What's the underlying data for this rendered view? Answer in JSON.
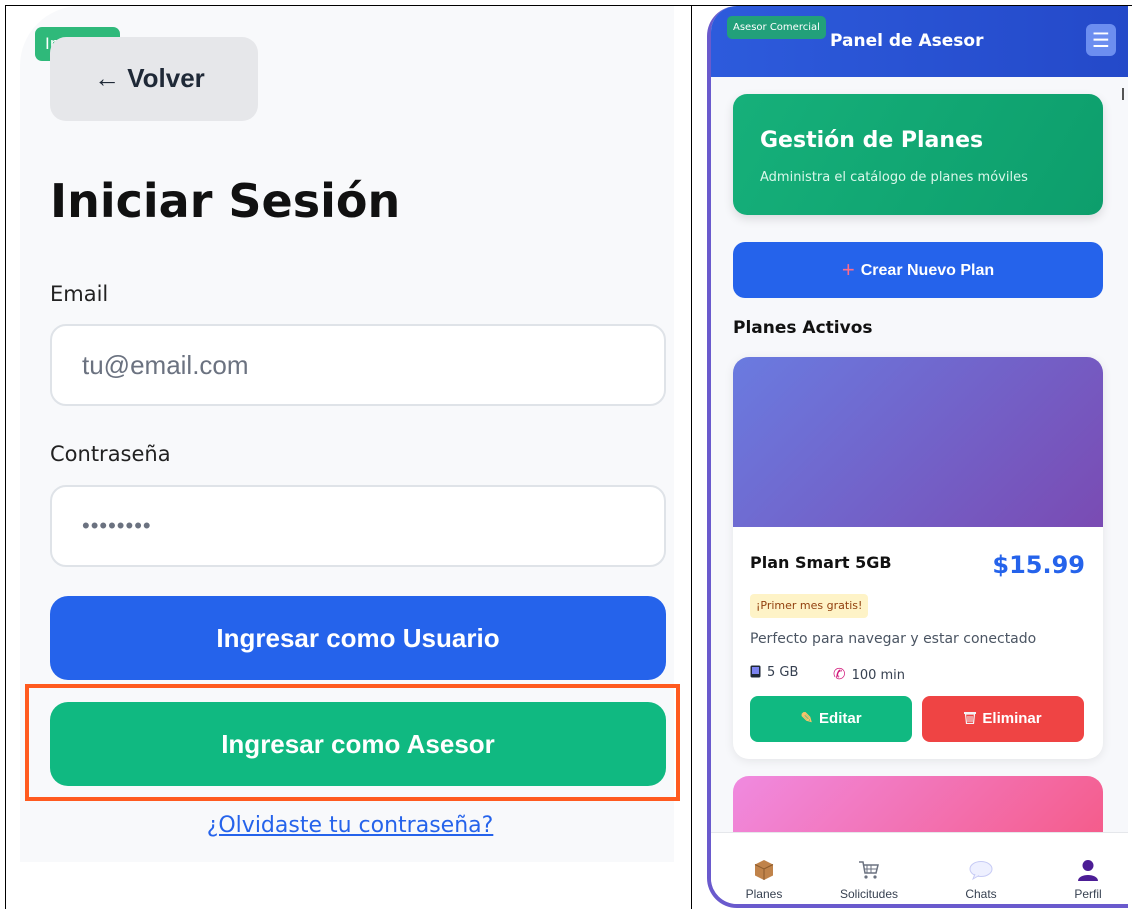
{
  "left": {
    "guest_badge": "Invitado",
    "back_label": "← Volver",
    "title": "Iniciar Sesión",
    "email_label": "Email",
    "email_placeholder": "tu@email.com",
    "password_label": "Contraseña",
    "password_value": "••••••••",
    "login_user_label": "Ingresar como Usuario",
    "login_advisor_label": "Ingresar como Asesor",
    "forgot_label": "¿Olvidaste tu contraseña?"
  },
  "right": {
    "role_badge": "Asesor Comercial",
    "header_title": "Panel de Asesor",
    "menu_icon": "☰",
    "hero_title": "Gestión de Planes",
    "hero_subtitle": "Administra el catálogo de planes móviles",
    "create_plus": "+",
    "create_label": "Crear Nuevo Plan",
    "section_title": "Planes Activos",
    "plan": {
      "name": "Plan Smart 5GB",
      "price": "$15.99",
      "promo": "¡Primer mes gratis!",
      "description": "Perfecto para navegar y estar conectado",
      "data": "5 GB",
      "minutes": "100 min",
      "edit_label": "Editar",
      "delete_label": "Eliminar"
    },
    "nav": [
      {
        "label": "Planes",
        "icon": "package-icon"
      },
      {
        "label": "Solicitudes",
        "icon": "cart-icon"
      },
      {
        "label": "Chats",
        "icon": "chat-bubble-icon"
      },
      {
        "label": "Perfil",
        "icon": "user-icon"
      }
    ]
  },
  "colors": {
    "primary_blue": "#2563eb",
    "green": "#10b981",
    "red": "#ef4444",
    "highlight_orange": "#ff5a1f",
    "frame_purple": "#6a5acd"
  }
}
